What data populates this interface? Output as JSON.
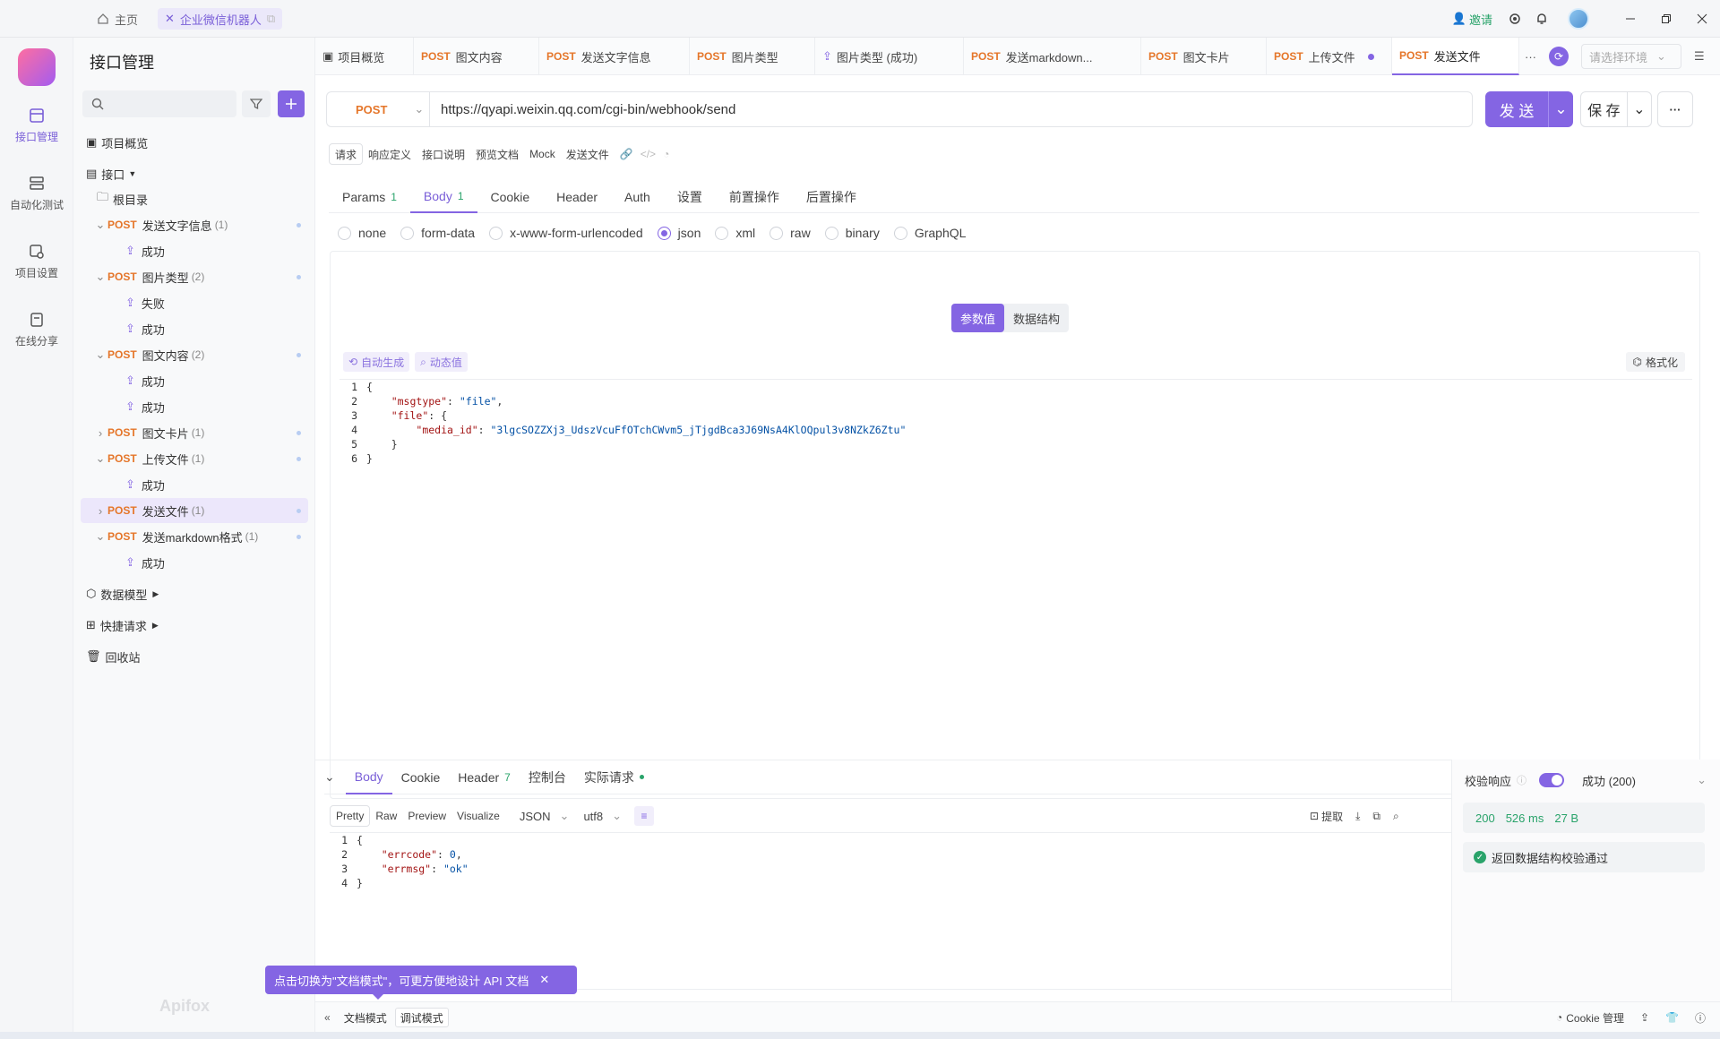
{
  "window": {
    "home_tab": "主页",
    "project_tab": "企业微信机器人",
    "invite": "邀请"
  },
  "rail": {
    "items": [
      "接口管理",
      "自动化测试",
      "项目设置",
      "在线分享"
    ]
  },
  "sidebar": {
    "title": "接口管理",
    "overview": "项目概览",
    "api_group": "接口",
    "root": "根目录",
    "tree": [
      {
        "method": "POST",
        "name": "发送文字信息",
        "count": "(1)"
      },
      {
        "name": "成功"
      },
      {
        "method": "POST",
        "name": "图片类型",
        "count": "(2)"
      },
      {
        "name": "失败"
      },
      {
        "name": "成功"
      },
      {
        "method": "POST",
        "name": "图文内容",
        "count": "(2)"
      },
      {
        "name": "成功"
      },
      {
        "name": "成功"
      },
      {
        "method": "POST",
        "name": "图文卡片",
        "count": "(1)"
      },
      {
        "method": "POST",
        "name": "上传文件",
        "count": "(1)"
      },
      {
        "name": "成功"
      },
      {
        "method": "POST",
        "name": "发送文件",
        "count": "(1)"
      },
      {
        "method": "POST",
        "name": "发送markdown格式",
        "count": "(1)"
      },
      {
        "name": "成功"
      }
    ],
    "data_model": "数据模型",
    "quick_request": "快捷请求",
    "recycle": "回收站"
  },
  "tabs": [
    {
      "method": "",
      "name": "项目概览"
    },
    {
      "method": "POST",
      "name": "图文内容"
    },
    {
      "method": "POST",
      "name": "发送文字信息"
    },
    {
      "method": "POST",
      "name": "图片类型"
    },
    {
      "method": "",
      "name": "图片类型 (成功)"
    },
    {
      "method": "POST",
      "name": "发送markdown..."
    },
    {
      "method": "POST",
      "name": "图文卡片"
    },
    {
      "method": "POST",
      "name": "上传文件"
    },
    {
      "method": "POST",
      "name": "发送文件"
    }
  ],
  "env_placeholder": "请选择环境",
  "request": {
    "method": "POST",
    "url": "https://qyapi.weixin.qq.com/cgi-bin/webhook/send",
    "send": "发 送",
    "save": "保 存"
  },
  "subtabs": [
    "请求",
    "响应定义",
    "接口说明",
    "预览文档",
    "Mock",
    "发送文件"
  ],
  "req_tabs": [
    {
      "label": "Params",
      "count": "1"
    },
    {
      "label": "Body",
      "count": "1"
    },
    {
      "label": "Cookie",
      "count": ""
    },
    {
      "label": "Header",
      "count": ""
    },
    {
      "label": "Auth",
      "count": ""
    },
    {
      "label": "设置",
      "count": ""
    },
    {
      "label": "前置操作",
      "count": ""
    },
    {
      "label": "后置操作",
      "count": ""
    }
  ],
  "body_types": [
    "none",
    "form-data",
    "x-www-form-urlencoded",
    "json",
    "xml",
    "raw",
    "binary",
    "GraphQL"
  ],
  "body_selected": "json",
  "body_toggle": {
    "values": "参数值",
    "schema": "数据结构"
  },
  "editor_tools": {
    "auto": "自动生成",
    "dynamic": "动态值",
    "format": "格式化"
  },
  "request_body": {
    "line1": "{",
    "k1": "\"msgtype\"",
    "v1": "\"file\"",
    "k2": "\"file\"",
    "k3": "\"media_id\"",
    "v3": "\"3lgcSOZZXj3_UdszVcuFfOTchCWvm5_jTjgdBca3J69NsA4KlOQpul3v8NZkZ6Ztu\"",
    "line5": "}",
    "line6": "}"
  },
  "resp_tabs": [
    {
      "label": "Body",
      "count": ""
    },
    {
      "label": "Cookie",
      "count": ""
    },
    {
      "label": "Header",
      "count": "7"
    },
    {
      "label": "控制台",
      "count": ""
    },
    {
      "label": "实际请求",
      "count": ""
    }
  ],
  "resp_tools": [
    "Pretty",
    "Raw",
    "Preview",
    "Visualize"
  ],
  "resp_format": "JSON",
  "resp_encoding": "utf8",
  "resp_actions": {
    "extract": "提取"
  },
  "response_body": {
    "k1": "\"errcode\"",
    "v1": "0",
    "k2": "\"errmsg\"",
    "v2": "\"ok\""
  },
  "validation": {
    "label": "校验响应",
    "result": "成功 (200)",
    "status": "200",
    "time": "526 ms",
    "size": "27 B",
    "passed": "返回数据结构校验通过"
  },
  "toast": "点击切换为\"文档模式\"，可更方便地设计 API 文档",
  "modes": {
    "doc": "文档模式",
    "debug": "调试模式"
  },
  "cookie_mgmt": "Cookie 管理",
  "watermark": "Apifox",
  "colors": {
    "accent": "#8465e3",
    "post": "#e5762a",
    "success": "#29a36a"
  }
}
